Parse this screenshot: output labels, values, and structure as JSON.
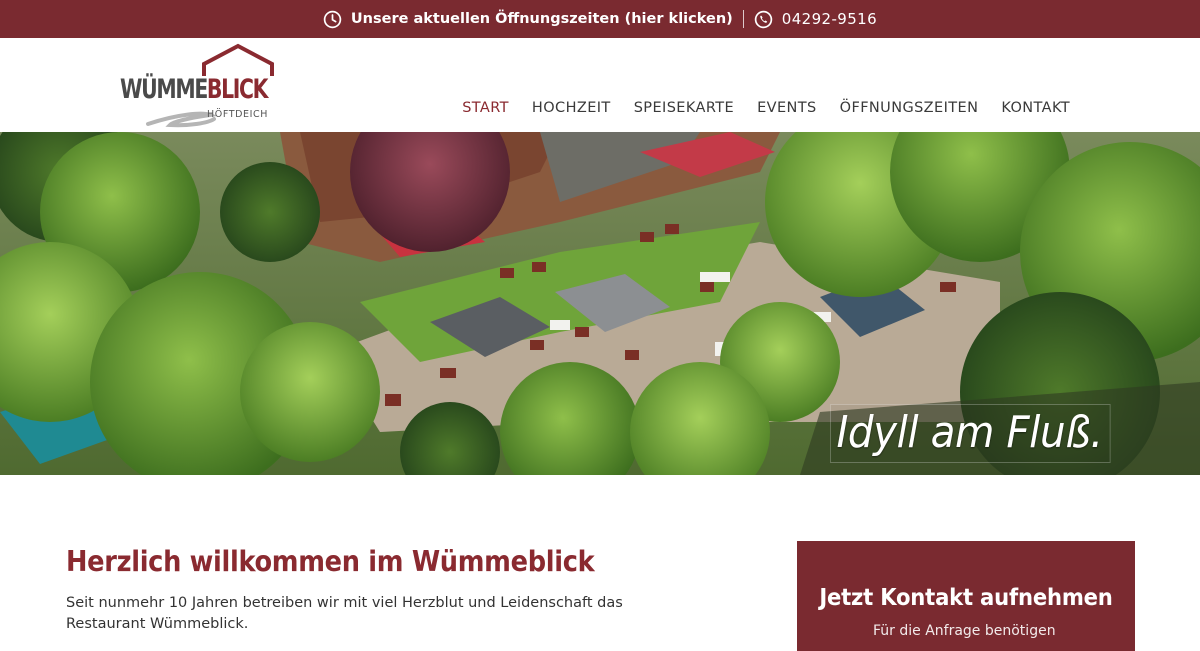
{
  "topbar": {
    "hours_link": "Unsere aktuellen Öffnungszeiten (hier klicken)",
    "phone": "04292-9516",
    "clock_icon": "clock-icon",
    "phone_icon": "phone-icon"
  },
  "logo": {
    "word_part1": "WÜMME",
    "word_part2": "BLICK",
    "sub": "HÖFTDEICH"
  },
  "nav": {
    "items": [
      {
        "label": "START",
        "active": true
      },
      {
        "label": "HOCHZEIT"
      },
      {
        "label": "SPEISEKARTE"
      },
      {
        "label": "EVENTS"
      },
      {
        "label": "ÖFFNUNGSZEITEN"
      },
      {
        "label": "KONTAKT"
      }
    ]
  },
  "hero": {
    "caption": "Idyll am Fluß."
  },
  "welcome": {
    "title": "Herzlich willkommen im Wümmeblick",
    "text": "Seit nunmehr 10 Jahren betreiben wir mit viel Herzblut und Leidenschaft das Restaurant Wümmeblick."
  },
  "contact": {
    "title": "Jetzt Kontakt aufnehmen",
    "sub": "Für die Anfrage benötigen"
  },
  "colors": {
    "brand": "#7a2a30",
    "accent": "#8a2a30"
  }
}
